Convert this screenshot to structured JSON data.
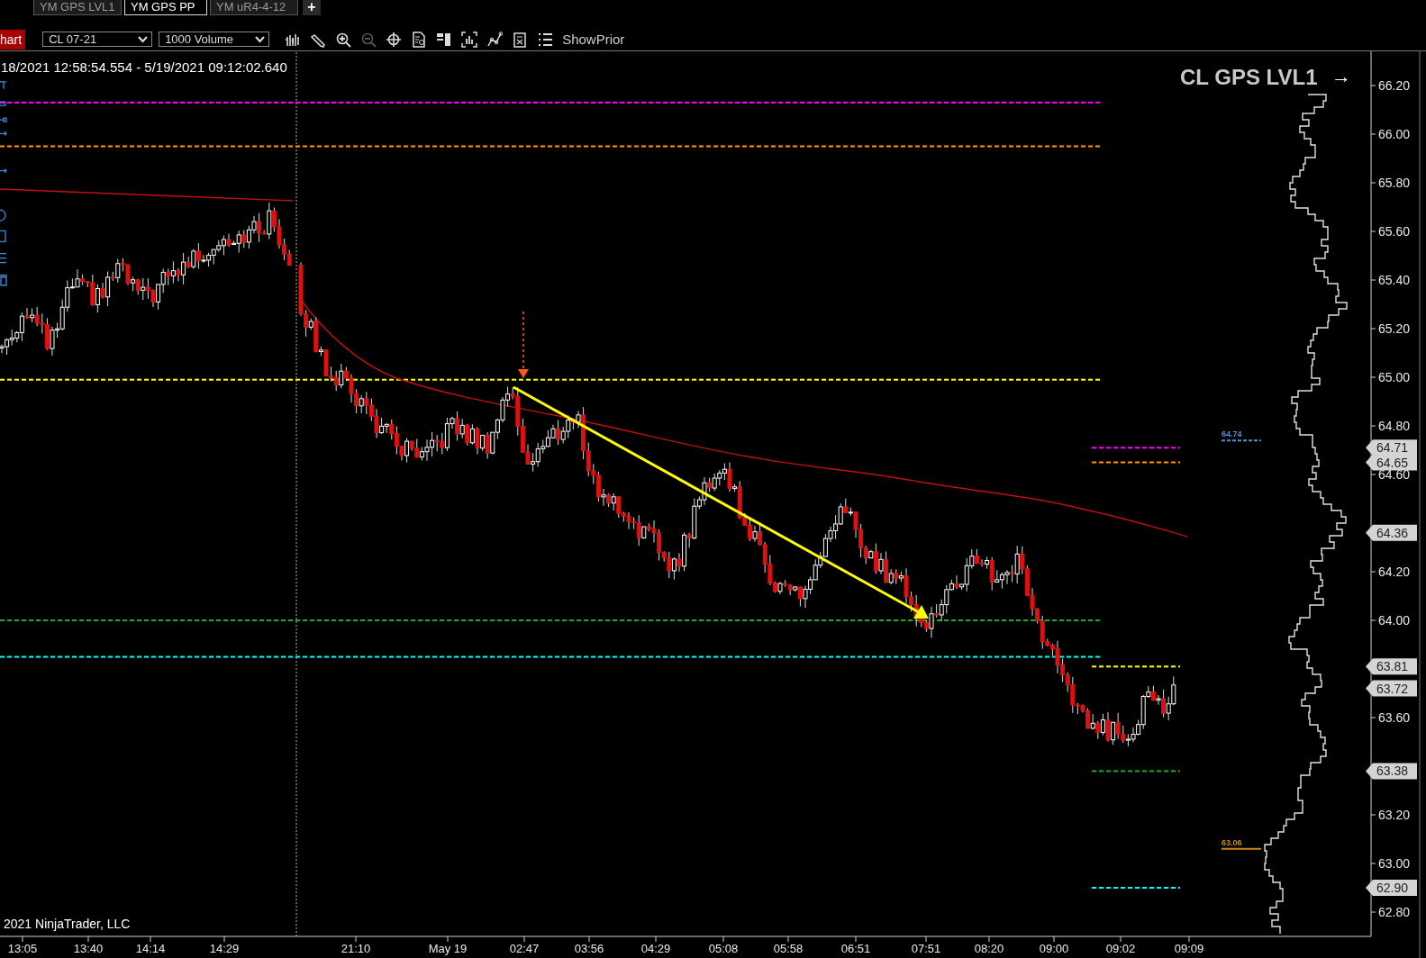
{
  "tabs": [
    {
      "label": "YM GPS LVL1",
      "selected": false
    },
    {
      "label": "YM GPS PP",
      "selected": true
    },
    {
      "label": "YM uR4-4-12",
      "selected": false
    }
  ],
  "add_tab_button": "+",
  "toolbar": {
    "chart_button": "hart",
    "instrument": "CL 07-21",
    "interval": "1000 Volume",
    "icons": [
      {
        "kind": "bars",
        "disabled": false
      },
      {
        "kind": "pencil",
        "disabled": false
      },
      {
        "kind": "zoom-in",
        "disabled": false
      },
      {
        "kind": "zoom-out",
        "disabled": true
      },
      {
        "kind": "crosshair",
        "disabled": false
      },
      {
        "kind": "data-box",
        "disabled": false
      },
      {
        "kind": "panels",
        "disabled": false
      },
      {
        "kind": "chart-frame",
        "disabled": false
      },
      {
        "kind": "line-chart",
        "disabled": false
      },
      {
        "kind": "clipboard",
        "disabled": false
      },
      {
        "kind": "list",
        "disabled": false
      }
    ],
    "show_prior_button": "ShowPrior"
  },
  "chart": {
    "time_range": "18/2021 12:58:54.554 - 5/19/2021 09:12:02.640",
    "title": "CL GPS LVL1",
    "title_arrow": "→",
    "copyright": "2021 NinjaTrader, LLC",
    "price_axis": [
      "66.20",
      "66.00",
      "65.80",
      "65.60",
      "65.40",
      "65.20",
      "65.00",
      "64.80",
      "64.60",
      "64.20",
      "64.00",
      "63.60",
      "63.20",
      "63.00",
      "62.80"
    ],
    "time_axis": [
      "13:05",
      "13:40",
      "14:14",
      "14:29",
      "21:10",
      "May 19",
      "02:47",
      "03:56",
      "04:29",
      "05:08",
      "05:58",
      "06:51",
      "07:51",
      "08:20",
      "09:00",
      "09:02",
      "09:09"
    ],
    "levels": [
      {
        "kind": "full",
        "color": "#ff00ff"
      },
      {
        "kind": "full",
        "color": "#ff9900"
      },
      {
        "kind": "full",
        "color": "#ffff00"
      },
      {
        "kind": "full",
        "color": "#22aa22"
      },
      {
        "kind": "full",
        "color": "#00ffff"
      },
      {
        "kind": "short",
        "color": "#ff00ff"
      },
      {
        "kind": "short",
        "color": "#ff9900"
      },
      {
        "kind": "short",
        "color": "#ffff00"
      },
      {
        "kind": "short",
        "color": "#22aa22"
      },
      {
        "kind": "short",
        "color": "#00ffff"
      }
    ],
    "price_markers": [
      "64.71",
      "64.65",
      "64.36",
      "63.81",
      "63.72",
      "63.38",
      "62.90"
    ],
    "profile_labels": [
      {
        "label": "64.74",
        "color": "#5b8fd8"
      },
      {
        "label": "63.06",
        "color": "#c88a10"
      }
    ]
  }
}
